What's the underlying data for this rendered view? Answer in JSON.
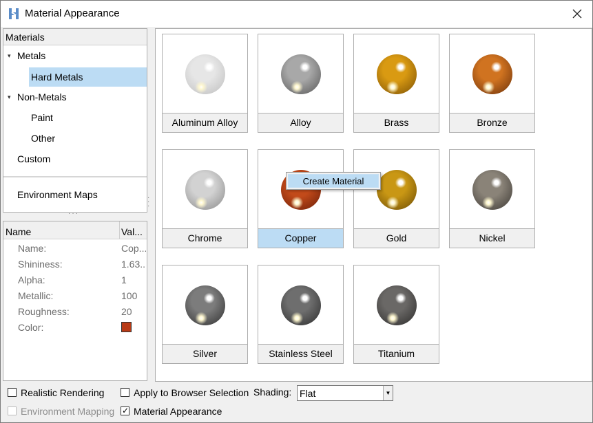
{
  "window": {
    "title": "Material Appearance"
  },
  "tree": {
    "header": "Materials",
    "items": [
      {
        "label": "Metals",
        "expanded": true
      },
      {
        "label": "Hard Metals",
        "selected": true
      },
      {
        "label": "Non-Metals",
        "expanded": true
      },
      {
        "label": "Paint"
      },
      {
        "label": "Other"
      },
      {
        "label": "Custom"
      }
    ],
    "env_maps": "Environment Maps"
  },
  "properties": {
    "col_name": "Name",
    "col_value": "Val...",
    "rows": [
      {
        "name": "Name:",
        "value": "Cop..."
      },
      {
        "name": "Shininess:",
        "value": "1.63..."
      },
      {
        "name": "Alpha:",
        "value": "1"
      },
      {
        "name": "Metallic:",
        "value": "100"
      },
      {
        "name": "Roughness:",
        "value": "20"
      },
      {
        "name": "Color:",
        "value": ""
      }
    ],
    "color_value": "#b83a16"
  },
  "materials": [
    {
      "label": "Aluminum Alloy",
      "base": "#e6e6e6",
      "dark": "#bdbdbd"
    },
    {
      "label": "Alloy",
      "base": "#a8a8a8",
      "dark": "#555555"
    },
    {
      "label": "Brass",
      "base": "#d99a12",
      "dark": "#7a4f05"
    },
    {
      "label": "Bronze",
      "base": "#d07320",
      "dark": "#6a300a"
    },
    {
      "label": "Chrome",
      "base": "#d2d2d2",
      "dark": "#888888"
    },
    {
      "label": "Copper",
      "base": "#c24a1a",
      "dark": "#6a1e08",
      "selected": true
    },
    {
      "label": "Gold",
      "base": "#c99714",
      "dark": "#6a4a05"
    },
    {
      "label": "Nickel",
      "base": "#8a8378",
      "dark": "#3c3833"
    },
    {
      "label": "Silver",
      "base": "#7c7c7c",
      "dark": "#2e2e2e"
    },
    {
      "label": "Stainless Steel",
      "base": "#6e6e6e",
      "dark": "#2a2a2a"
    },
    {
      "label": "Titanium",
      "base": "#6a6866",
      "dark": "#2b2a29"
    }
  ],
  "context_menu": {
    "item": "Create Material"
  },
  "bottom": {
    "realistic_rendering": "Realistic Rendering",
    "apply_browser": "Apply to Browser Selection",
    "shading_label": "Shading:",
    "shading_value": "Flat",
    "environment_mapping": "Environment Mapping",
    "material_appearance": "Material Appearance"
  }
}
